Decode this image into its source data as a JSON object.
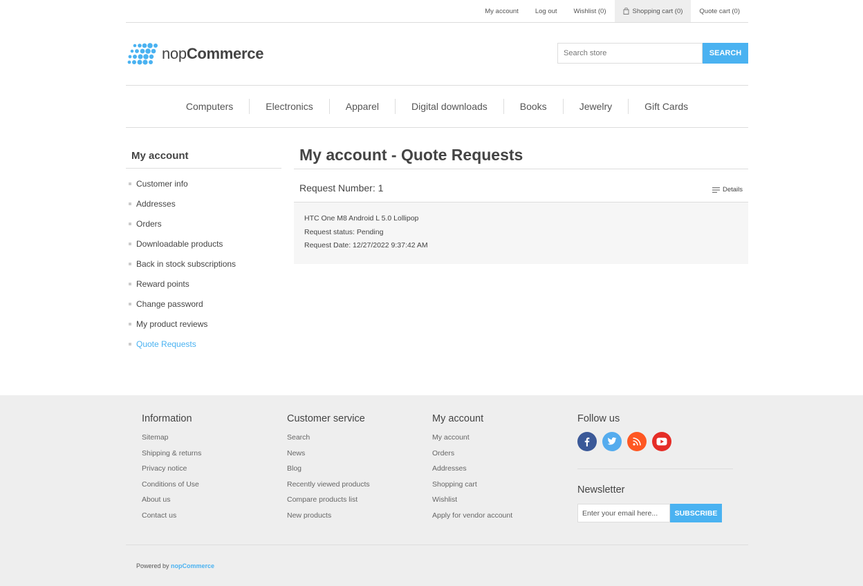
{
  "header": {
    "links": [
      {
        "label": "My account",
        "name": "header-link-my-account"
      },
      {
        "label": "Log out",
        "name": "header-link-logout"
      },
      {
        "label": "Wishlist (0)",
        "name": "header-link-wishlist"
      },
      {
        "label": "Shopping cart (0)",
        "name": "header-link-shopping-cart"
      },
      {
        "label": "Quote cart (0)",
        "name": "header-link-quote-cart"
      }
    ],
    "logo": {
      "prefix": "nop",
      "suffix": "Commerce",
      "icon": "nopcommerce-dots-logo",
      "color": "#4ab2f1"
    },
    "search": {
      "placeholder": "Search store",
      "button": "Search"
    }
  },
  "nav": {
    "items": [
      "Computers",
      "Electronics",
      "Apparel",
      "Digital downloads",
      "Books",
      "Jewelry",
      "Gift Cards"
    ]
  },
  "sidebar": {
    "title": "My account",
    "items": [
      {
        "label": "Customer info",
        "active": false
      },
      {
        "label": "Addresses",
        "active": false
      },
      {
        "label": "Orders",
        "active": false
      },
      {
        "label": "Downloadable products",
        "active": false
      },
      {
        "label": "Back in stock subscriptions",
        "active": false
      },
      {
        "label": "Reward points",
        "active": false
      },
      {
        "label": "Change password",
        "active": false
      },
      {
        "label": "My product reviews",
        "active": false
      },
      {
        "label": "Quote Requests",
        "active": true
      }
    ]
  },
  "main": {
    "title": "My account - Quote Requests",
    "request": {
      "number_label": "Request Number: 1",
      "details_label": "Details",
      "product": "HTC One M8 Android L 5.0 Lollipop",
      "status": "Request status: Pending",
      "date": "Request Date: 12/27/2022 9:37:42 AM"
    }
  },
  "footer": {
    "information": {
      "title": "Information",
      "items": [
        "Sitemap",
        "Shipping & returns",
        "Privacy notice",
        "Conditions of Use",
        "About us",
        "Contact us"
      ]
    },
    "customer_service": {
      "title": "Customer service",
      "items": [
        "Search",
        "News",
        "Blog",
        "Recently viewed products",
        "Compare products list",
        "New products"
      ]
    },
    "my_account": {
      "title": "My account",
      "items": [
        "My account",
        "Orders",
        "Addresses",
        "Shopping cart",
        "Wishlist",
        "Apply for vendor account"
      ]
    },
    "follow": {
      "title": "Follow us",
      "icons": [
        "facebook-icon",
        "twitter-icon",
        "rss-icon",
        "youtube-icon"
      ]
    },
    "newsletter": {
      "title": "Newsletter",
      "placeholder": "Enter your email here...",
      "button": "SUBSCRIBE"
    },
    "powered": {
      "prefix": "Powered by",
      "link": "nopCommerce"
    }
  },
  "colors": {
    "accent": "#4ab2f1",
    "facebook": "#3b5998",
    "twitter": "#55acee",
    "rss": "#fe5722",
    "youtube": "#e52d27",
    "footer_bg": "#eeeeee"
  }
}
